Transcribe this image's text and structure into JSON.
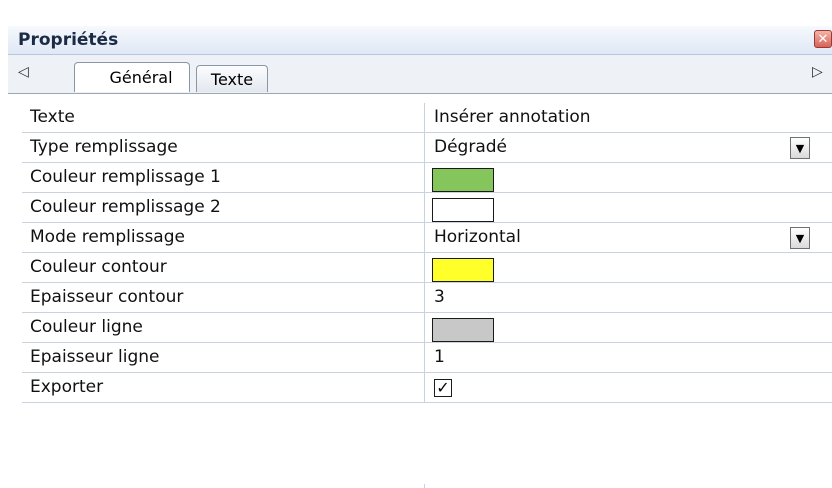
{
  "panel": {
    "title": "Propriétés",
    "close_glyph": "✕"
  },
  "tabs": {
    "scroll_left": "◁",
    "scroll_right": "▷",
    "items": [
      {
        "label": "Général",
        "active": true
      },
      {
        "label": "Texte",
        "active": false
      }
    ]
  },
  "properties": [
    {
      "name": "Texte",
      "type": "text",
      "value": "Insérer annotation"
    },
    {
      "name": "Type remplissage",
      "type": "dropdown",
      "value": "Dégradé"
    },
    {
      "name": "Couleur remplissage 1",
      "type": "color",
      "color": "#84c65b"
    },
    {
      "name": "Couleur remplissage 2",
      "type": "color",
      "color": "#ffffff"
    },
    {
      "name": "Mode remplissage",
      "type": "dropdown",
      "value": "Horizontal"
    },
    {
      "name": "Couleur contour",
      "type": "color",
      "color": "#ffff2a"
    },
    {
      "name": "Epaisseur contour",
      "type": "text",
      "value": "3"
    },
    {
      "name": "Couleur ligne",
      "type": "color",
      "color": "#c8c8c8"
    },
    {
      "name": "Epaisseur ligne",
      "type": "text",
      "value": "1"
    },
    {
      "name": "Exporter",
      "type": "checkbox",
      "checked": true,
      "check_glyph": "✓"
    }
  ],
  "dropdown_arrow": "▼"
}
